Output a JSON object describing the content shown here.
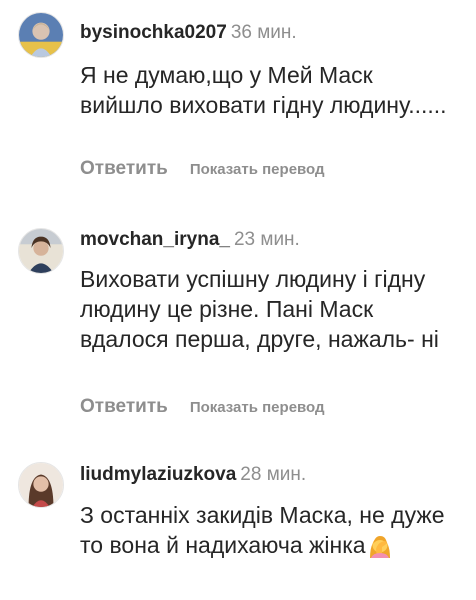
{
  "comments": [
    {
      "username": "bysinochka0207",
      "time": "36 мин.",
      "text": "Я не думаю,що у Мей Маск вийшло виховати гідну людину......",
      "reply_label": "Ответить",
      "translate_label": "Показать перевод",
      "avatar_icon": "profile-photo-woman-blue-background"
    },
    {
      "username": "movchan_iryna_",
      "time": "23 мин.",
      "text": "Виховати успішну людину і гідну людину це різне. Пані Маск вдалося перша, друге, нажаль- ні",
      "reply_label": "Ответить",
      "translate_label": "Показать перевод",
      "avatar_icon": "profile-photo-woman-dark-hair"
    },
    {
      "username": "liudmylaziuzkova",
      "time": "28 мин.",
      "text": "З останніх закидів Маска, не дуже то вона й надихаюча жінка",
      "emoji": "woman-facepalming-emoji",
      "avatar_icon": "profile-photo-woman-brown-hair"
    }
  ],
  "colors": {
    "text": "#262626",
    "secondary": "#8e8e8e",
    "background": "#ffffff"
  }
}
